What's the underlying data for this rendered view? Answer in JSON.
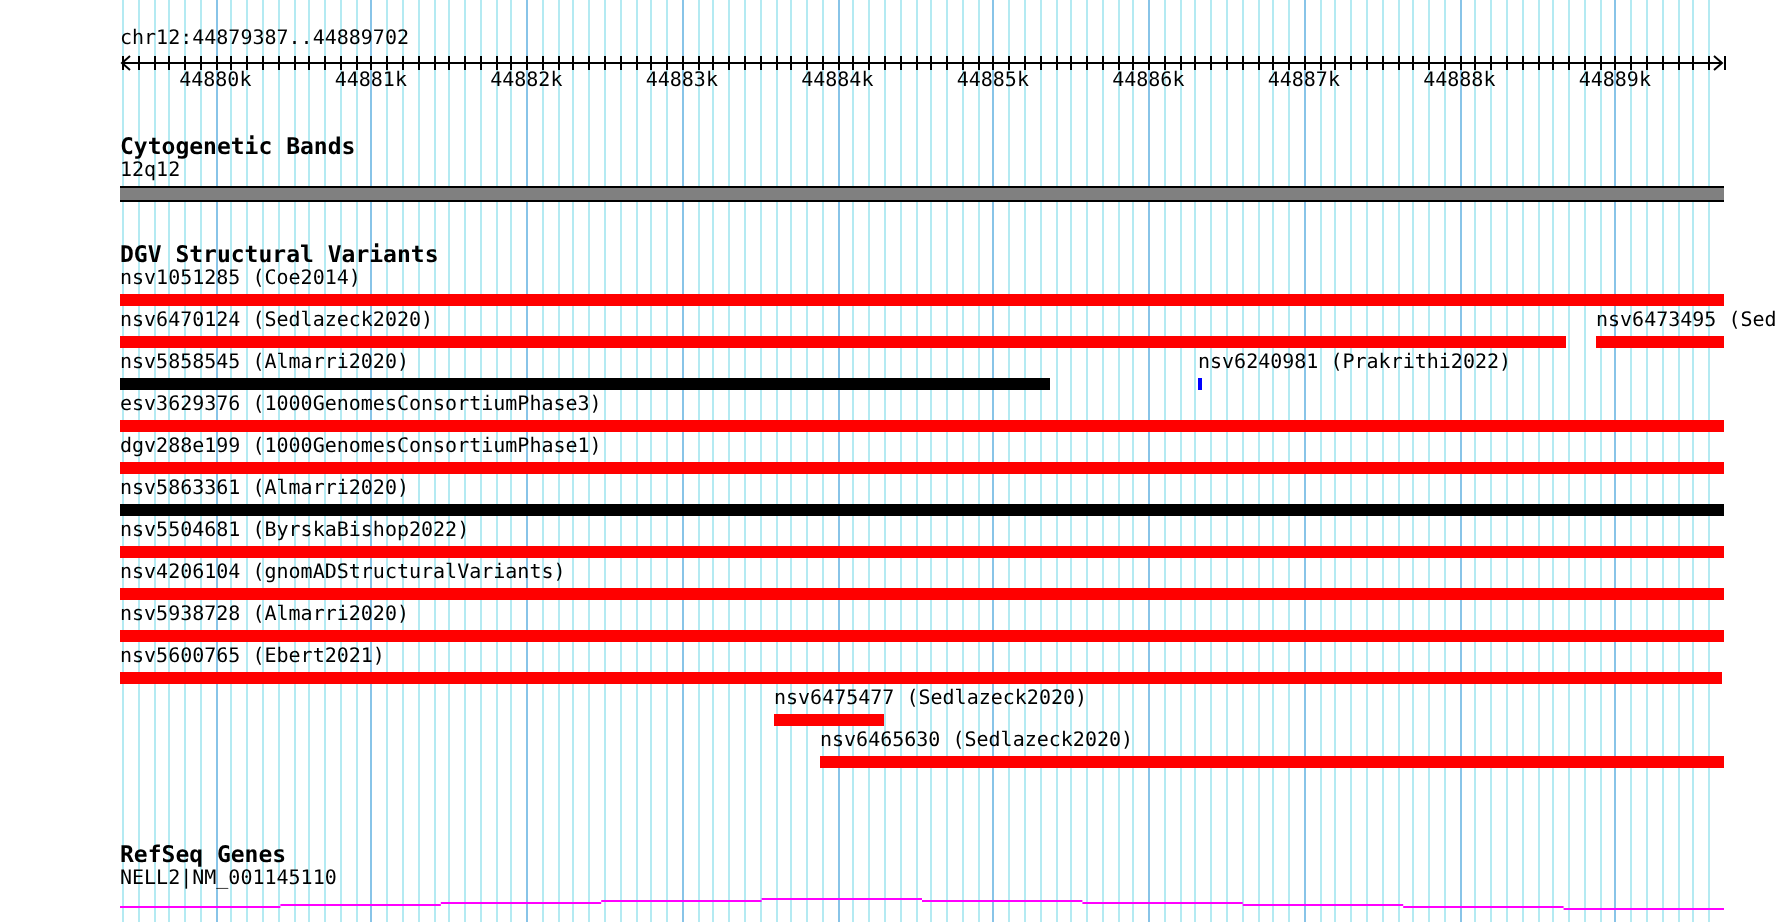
{
  "region": {
    "label": "chr12:44879387..44889702"
  },
  "ruler": {
    "ticks": [
      "44880k",
      "44881k",
      "44882k",
      "44883k",
      "44884k",
      "44885k",
      "44886k",
      "44887k",
      "44888k",
      "44889k"
    ]
  },
  "tracks": [
    {
      "kind": "bands",
      "title": "Cytogenetic Bands",
      "features": [
        {
          "label": "12q12",
          "color": "#808080"
        }
      ]
    },
    {
      "kind": "variants",
      "title": "DGV Structural Variants",
      "rows": [
        {
          "features": [
            {
              "label": "nsv1051285 (Coe2014)",
              "color": "#ff0000"
            }
          ]
        },
        {
          "features": [
            {
              "label": "nsv6470124 (Sedlazeck2020)",
              "color": "#ff0000"
            },
            {
              "label": "nsv6473495 (Sed",
              "color": "#ff0000"
            }
          ]
        },
        {
          "features": [
            {
              "label": "nsv5858545 (Almarri2020)",
              "color": "#000000"
            },
            {
              "label": "nsv6240981 (Prakrithi2022)",
              "color": "#0000ff"
            }
          ]
        },
        {
          "features": [
            {
              "label": "esv3629376 (1000GenomesConsortiumPhase3)",
              "color": "#ff0000"
            }
          ]
        },
        {
          "features": [
            {
              "label": "dgv288e199 (1000GenomesConsortiumPhase1)",
              "color": "#ff0000"
            }
          ]
        },
        {
          "features": [
            {
              "label": "nsv5863361 (Almarri2020)",
              "color": "#000000"
            }
          ]
        },
        {
          "features": [
            {
              "label": "nsv5504681 (ByrskaBishop2022)",
              "color": "#ff0000"
            }
          ]
        },
        {
          "features": [
            {
              "label": "nsv4206104 (gnomADStructuralVariants)",
              "color": "#ff0000"
            }
          ]
        },
        {
          "features": [
            {
              "label": "nsv5938728 (Almarri2020)",
              "color": "#ff0000"
            }
          ]
        },
        {
          "features": [
            {
              "label": "nsv5600765 (Ebert2021)",
              "color": "#ff0000"
            }
          ]
        },
        {
          "features": [
            {
              "label": "nsv6475477 (Sedlazeck2020)",
              "color": "#ff0000"
            }
          ]
        },
        {
          "features": [
            {
              "label": "nsv6465630 (Sedlazeck2020)",
              "color": "#ff0000"
            }
          ]
        }
      ]
    },
    {
      "kind": "gene",
      "title": "RefSeq Genes",
      "features": [
        {
          "label": "NELL2|NM_001145110",
          "color": "#ff00ff"
        }
      ]
    }
  ]
}
